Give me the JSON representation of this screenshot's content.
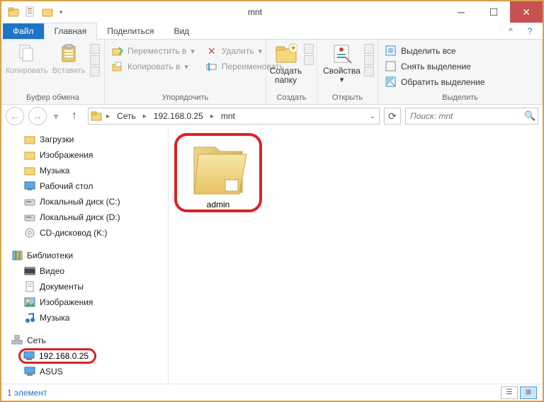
{
  "title": "mnt",
  "tabs": {
    "file": "Файл",
    "home": "Главная",
    "share": "Поделиться",
    "view": "Вид"
  },
  "ribbon": {
    "clipboard": {
      "copy": "Копировать",
      "paste": "Вставить",
      "label": "Буфер обмена"
    },
    "organize": {
      "move_to": "Переместить в",
      "copy_to": "Копировать в",
      "delete": "Удалить",
      "rename": "Переименовать",
      "label": "Упорядочить"
    },
    "new": {
      "new_folder_l1": "Создать",
      "new_folder_l2": "папку",
      "label": "Создать"
    },
    "open": {
      "properties": "Свойства",
      "label": "Открыть"
    },
    "select": {
      "select_all": "Выделить все",
      "select_none": "Снять выделение",
      "invert": "Обратить выделение",
      "label": "Выделить"
    }
  },
  "breadcrumb": {
    "seg1": "Сеть",
    "seg2": "192.168.0.25",
    "seg3": "mnt"
  },
  "search_placeholder": "Поиск: mnt",
  "tree": {
    "downloads": "Загрузки",
    "pictures": "Изображения",
    "music": "Музыка",
    "desktop": "Рабочий стол",
    "drive_c": "Локальный диск (C:)",
    "drive_d": "Локальный диск (D:)",
    "drive_k": "CD-дисковод (K:)",
    "libraries": "Библиотеки",
    "video": "Видео",
    "documents": "Документы",
    "lib_pictures": "Изображения",
    "lib_music": "Музыка",
    "network": "Сеть",
    "host1": "192.168.0.25",
    "host2": "ASUS"
  },
  "content_item": "admin",
  "status": "1 элемент"
}
